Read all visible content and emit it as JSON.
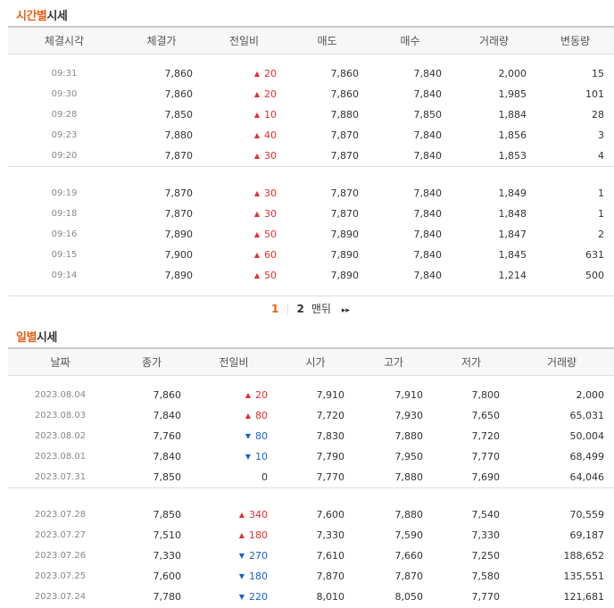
{
  "time_section": {
    "title_accent": "시간별",
    "title_rest": "시세",
    "headers": [
      "체결시각",
      "체결가",
      "전일비",
      "매도",
      "매수",
      "거래량",
      "변동량"
    ],
    "groups": [
      [
        {
          "time": "09:31",
          "price": "7,860",
          "dir": "up",
          "change": "20",
          "sell": "7,860",
          "buy": "7,840",
          "volume": "2,000",
          "delta": "15"
        },
        {
          "time": "09:30",
          "price": "7,860",
          "dir": "up",
          "change": "20",
          "sell": "7,860",
          "buy": "7,840",
          "volume": "1,985",
          "delta": "101"
        },
        {
          "time": "09:28",
          "price": "7,850",
          "dir": "up",
          "change": "10",
          "sell": "7,880",
          "buy": "7,850",
          "volume": "1,884",
          "delta": "28"
        },
        {
          "time": "09:23",
          "price": "7,880",
          "dir": "up",
          "change": "40",
          "sell": "7,870",
          "buy": "7,840",
          "volume": "1,856",
          "delta": "3"
        },
        {
          "time": "09:20",
          "price": "7,870",
          "dir": "up",
          "change": "30",
          "sell": "7,870",
          "buy": "7,840",
          "volume": "1,853",
          "delta": "4"
        }
      ],
      [
        {
          "time": "09:19",
          "price": "7,870",
          "dir": "up",
          "change": "30",
          "sell": "7,870",
          "buy": "7,840",
          "volume": "1,849",
          "delta": "1"
        },
        {
          "time": "09:18",
          "price": "7,870",
          "dir": "up",
          "change": "30",
          "sell": "7,870",
          "buy": "7,840",
          "volume": "1,848",
          "delta": "1"
        },
        {
          "time": "09:16",
          "price": "7,890",
          "dir": "up",
          "change": "50",
          "sell": "7,890",
          "buy": "7,840",
          "volume": "1,847",
          "delta": "2"
        },
        {
          "time": "09:15",
          "price": "7,900",
          "dir": "up",
          "change": "60",
          "sell": "7,890",
          "buy": "7,840",
          "volume": "1,845",
          "delta": "631"
        },
        {
          "time": "09:14",
          "price": "7,890",
          "dir": "up",
          "change": "50",
          "sell": "7,890",
          "buy": "7,840",
          "volume": "1,214",
          "delta": "500"
        }
      ]
    ]
  },
  "pagination": {
    "pages": [
      "1",
      "2"
    ],
    "active": "1",
    "last_label": "맨뒤",
    "next_icon": "double-chevron-right-icon",
    "next_glyph": "▸▸"
  },
  "daily_section": {
    "title_accent": "일별",
    "title_rest": "시세",
    "headers": [
      "날짜",
      "종가",
      "전일비",
      "시가",
      "고가",
      "저가",
      "거래량"
    ],
    "groups": [
      [
        {
          "date": "2023.08.04",
          "close": "7,860",
          "dir": "up",
          "change": "20",
          "open": "7,910",
          "high": "7,910",
          "low": "7,800",
          "volume": "2,000"
        },
        {
          "date": "2023.08.03",
          "close": "7,840",
          "dir": "up",
          "change": "80",
          "open": "7,720",
          "high": "7,930",
          "low": "7,650",
          "volume": "65,031"
        },
        {
          "date": "2023.08.02",
          "close": "7,760",
          "dir": "down",
          "change": "80",
          "open": "7,830",
          "high": "7,880",
          "low": "7,720",
          "volume": "50,004"
        },
        {
          "date": "2023.08.01",
          "close": "7,840",
          "dir": "down",
          "change": "10",
          "open": "7,790",
          "high": "7,950",
          "low": "7,770",
          "volume": "68,499"
        },
        {
          "date": "2023.07.31",
          "close": "7,850",
          "dir": "flat",
          "change": "0",
          "open": "7,770",
          "high": "7,880",
          "low": "7,690",
          "volume": "64,046"
        }
      ],
      [
        {
          "date": "2023.07.28",
          "close": "7,850",
          "dir": "up",
          "change": "340",
          "open": "7,600",
          "high": "7,880",
          "low": "7,540",
          "volume": "70,559"
        },
        {
          "date": "2023.07.27",
          "close": "7,510",
          "dir": "up",
          "change": "180",
          "open": "7,330",
          "high": "7,590",
          "low": "7,330",
          "volume": "69,187"
        },
        {
          "date": "2023.07.26",
          "close": "7,330",
          "dir": "down",
          "change": "270",
          "open": "7,610",
          "high": "7,660",
          "low": "7,250",
          "volume": "188,652"
        },
        {
          "date": "2023.07.25",
          "close": "7,600",
          "dir": "down",
          "change": "180",
          "open": "7,870",
          "high": "7,870",
          "low": "7,580",
          "volume": "135,551"
        },
        {
          "date": "2023.07.24",
          "close": "7,780",
          "dir": "down",
          "change": "220",
          "open": "8,010",
          "high": "8,050",
          "low": "7,770",
          "volume": "121,681"
        }
      ]
    ]
  },
  "colors": {
    "accent": "#e8611a",
    "up": "#e52e2e",
    "down": "#1664c8"
  }
}
